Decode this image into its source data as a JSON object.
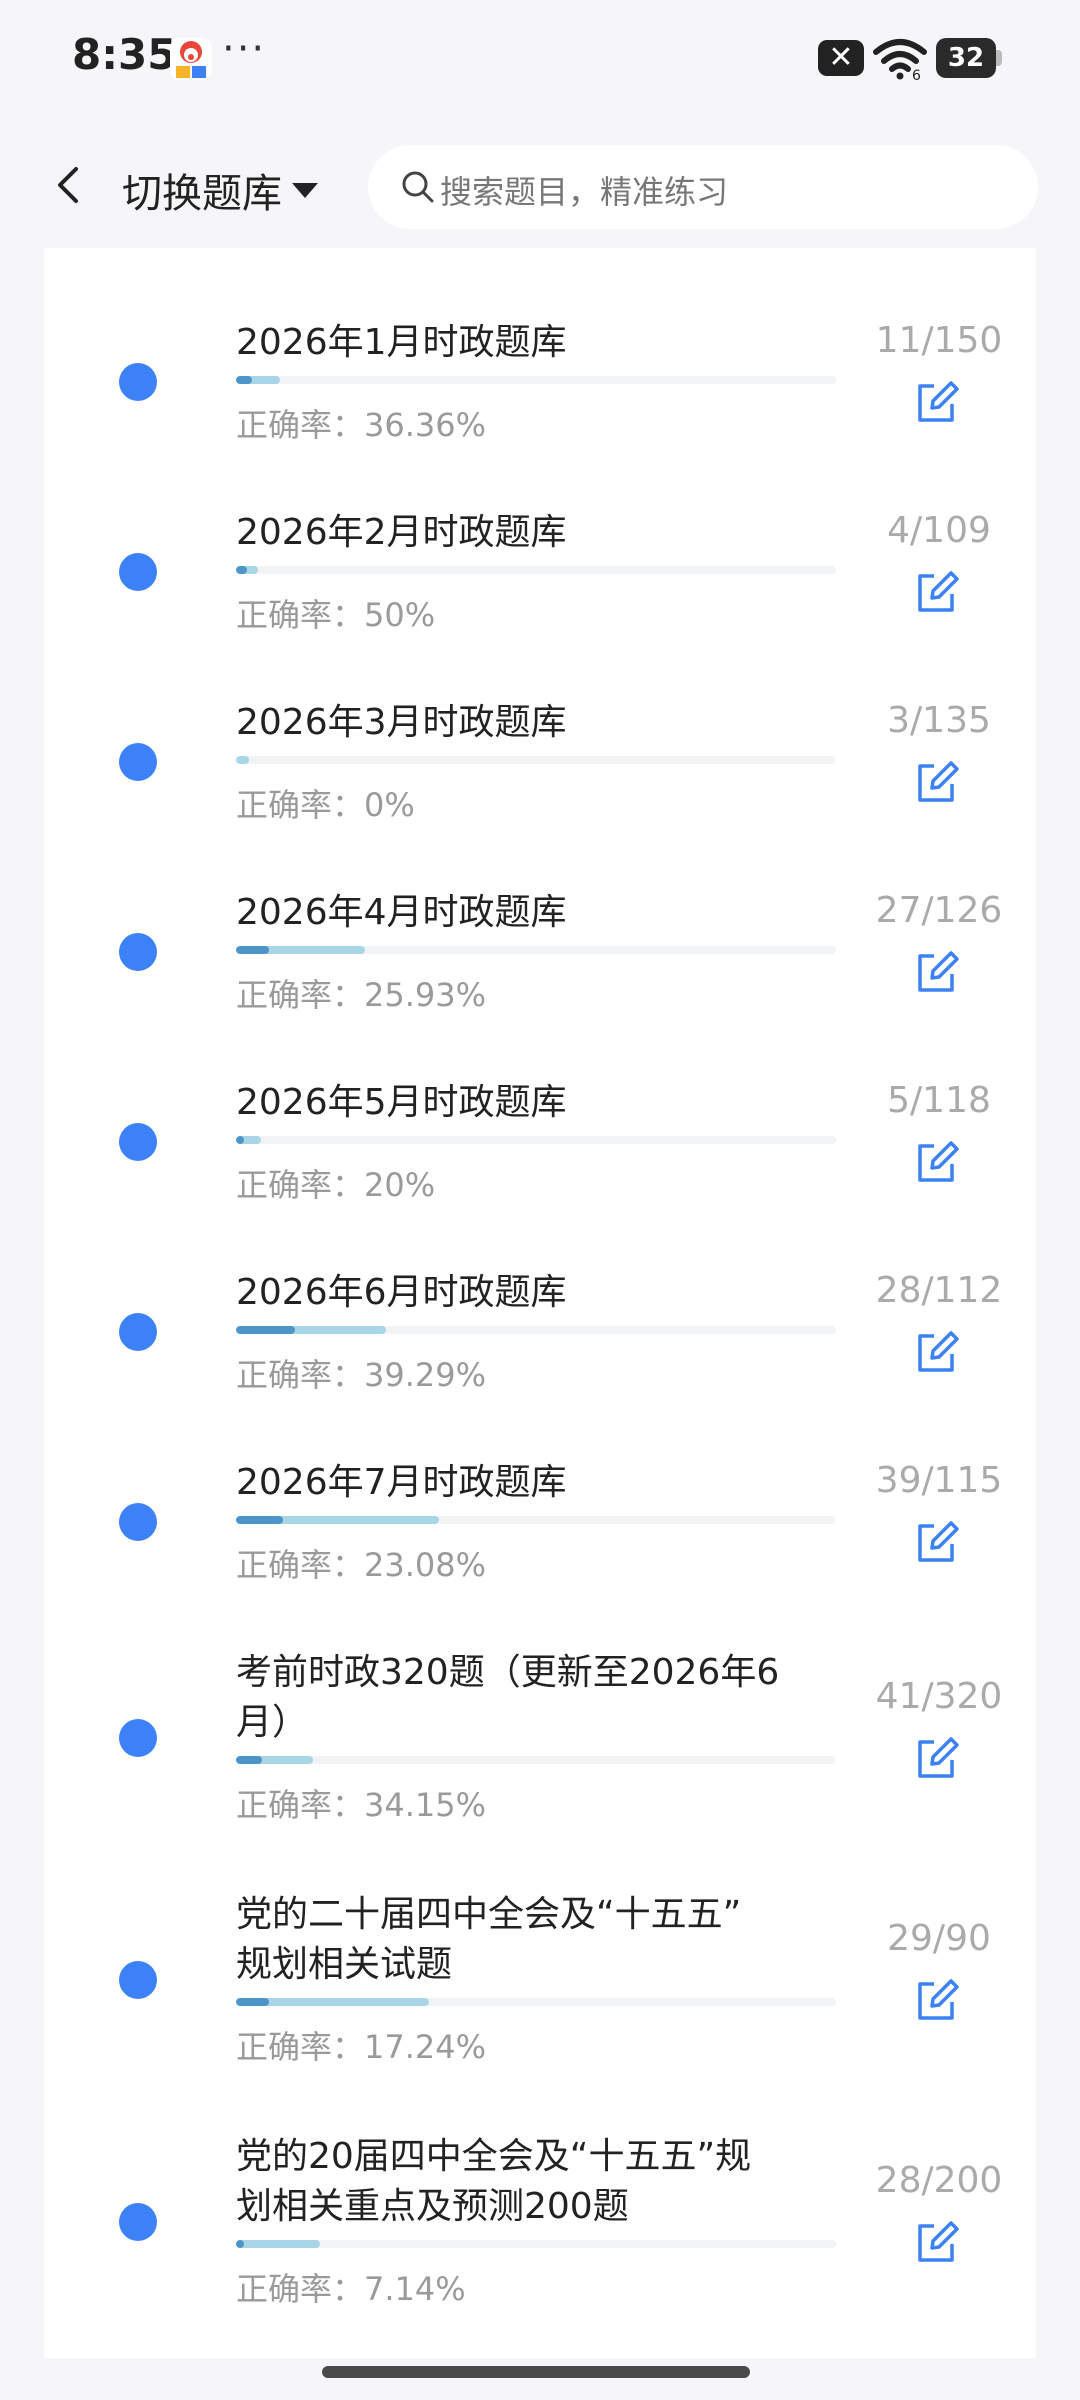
{
  "status_bar": {
    "time": "8:35",
    "more": "···",
    "battery": "32"
  },
  "header": {
    "switch_label": "切换题库",
    "search_placeholder": "搜索题目，精准练习"
  },
  "colors": {
    "accent": "#3c82f6",
    "progress_correct": "#4d95c9",
    "progress_done": "#a9d6e6"
  },
  "question_banks": [
    {
      "title_lines": [
        "2026年1月时政题库"
      ],
      "rate_label": "正确率：",
      "rate": "36.36%",
      "done": 11,
      "total": 150,
      "count": "11/150"
    },
    {
      "title_lines": [
        "2026年2月时政题库"
      ],
      "rate_label": "正确率：",
      "rate": "50%",
      "done": 4,
      "total": 109,
      "count": "4/109"
    },
    {
      "title_lines": [
        "2026年3月时政题库"
      ],
      "rate_label": "正确率：",
      "rate": "0%",
      "done": 3,
      "total": 135,
      "count": "3/135"
    },
    {
      "title_lines": [
        "2026年4月时政题库"
      ],
      "rate_label": "正确率：",
      "rate": "25.93%",
      "done": 27,
      "total": 126,
      "count": "27/126"
    },
    {
      "title_lines": [
        "2026年5月时政题库"
      ],
      "rate_label": "正确率：",
      "rate": "20%",
      "done": 5,
      "total": 118,
      "count": "5/118"
    },
    {
      "title_lines": [
        "2026年6月时政题库"
      ],
      "rate_label": "正确率：",
      "rate": "39.29%",
      "done": 28,
      "total": 112,
      "count": "28/112"
    },
    {
      "title_lines": [
        "2026年7月时政题库"
      ],
      "rate_label": "正确率：",
      "rate": "23.08%",
      "done": 39,
      "total": 115,
      "count": "39/115"
    },
    {
      "title_lines": [
        "考前时政320题（更新至2026年6",
        "月）"
      ],
      "rate_label": "正确率：",
      "rate": "34.15%",
      "done": 41,
      "total": 320,
      "count": "41/320"
    },
    {
      "title_lines": [
        "党的二十届四中全会及“十五五”",
        "规划相关试题"
      ],
      "rate_label": "正确率：",
      "rate": "17.24%",
      "done": 29,
      "total": 90,
      "count": "29/90"
    },
    {
      "title_lines": [
        "党的20届四中全会及“十五五”规",
        "划相关重点及预测200题"
      ],
      "rate_label": "正确率：",
      "rate": "7.14%",
      "done": 28,
      "total": 200,
      "count": "28/200"
    }
  ]
}
